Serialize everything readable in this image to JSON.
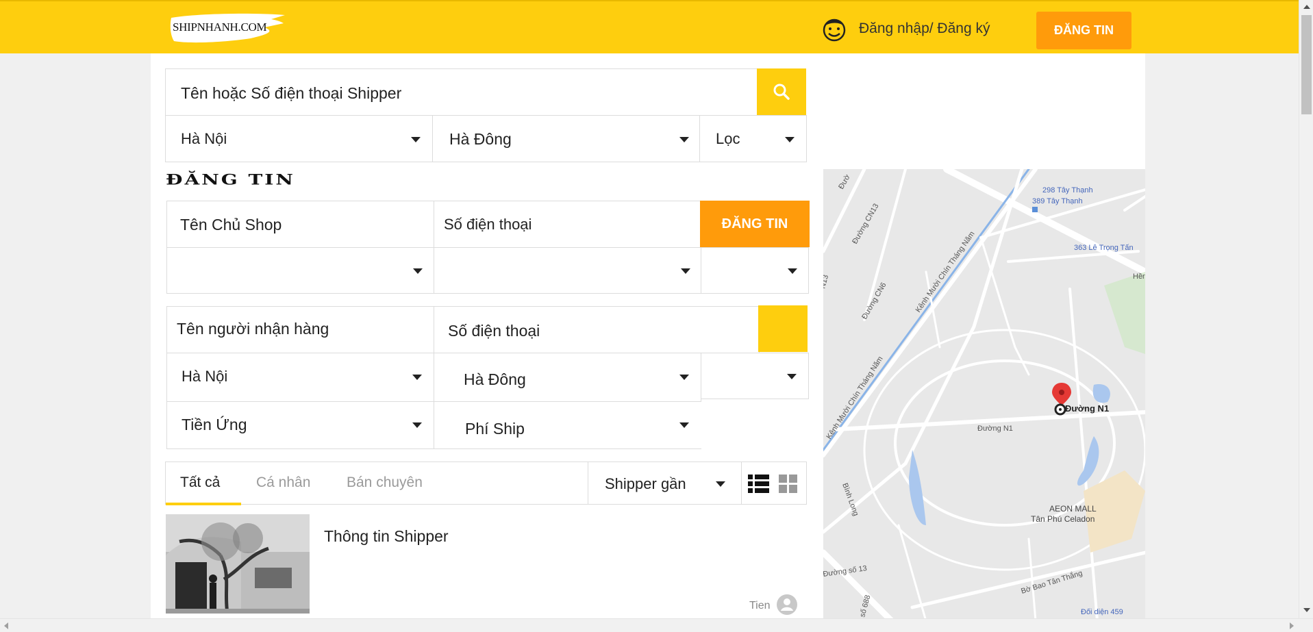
{
  "header": {
    "logo_text": "SHIPNHANH.COM",
    "login_label": "Đăng nhập/ Đăng ký",
    "post_button": "ĐĂNG TIN"
  },
  "search": {
    "placeholder": "Tên hoặc Số điện thoại Shipper",
    "city": "Hà Nội",
    "district": "Hà Đông",
    "filter": "Lọc"
  },
  "post_form": {
    "heading": "ĐĂNG TIN",
    "shop_owner_placeholder": "Tên Chủ Shop",
    "shop_phone_placeholder": "Số điện thoại",
    "submit_label": "ĐĂNG TIN",
    "receiver_name_placeholder": "Tên người nhận hàng",
    "receiver_phone_placeholder": "Số điện thoại",
    "receiver_city": "Hà Nội",
    "receiver_district": "Hà Đông",
    "advance_money": "Tiền Ứng",
    "ship_fee": "Phí Ship"
  },
  "tabs": {
    "all": "Tất cả",
    "personal": "Cá nhân",
    "professional": "Bán chuyên",
    "sort": "Shipper gần",
    "active": "all"
  },
  "listing": {
    "title": "Thông tin Shipper",
    "user": "Tien"
  },
  "map": {
    "labels": {
      "l1": "298 Tây Thạnh",
      "l2": "389 Tây Thạnh",
      "l3": "363 Lê Trọng Tấn",
      "l4": "Đường CN13",
      "l5": "Đường CN6",
      "l6": "Kênh Mười Chín Tháng Năm",
      "l7": "Kênh Mười Chín Tháng Năm",
      "l8": "Đường N1",
      "l9": "Đường N1",
      "l10": "AEON MALL",
      "l11": "Tân Phú Celadon",
      "l12": "Bình Long",
      "l13": "Đường số 13",
      "l14": "Bờ Bao Tân Thắng",
      "l15": "Đối diện 459",
      "l16": "N13",
      "l17": "Hền",
      "l18": "Đườ",
      "l19": "số 688"
    }
  },
  "colors": {
    "brand_yellow": "#fece0e",
    "accent_orange": "#ff9b0b"
  }
}
